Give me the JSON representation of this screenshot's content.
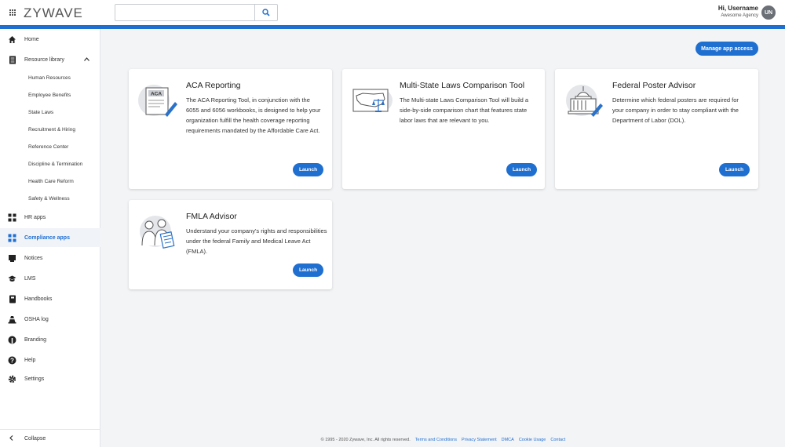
{
  "header": {
    "logo": "ZYWAVE",
    "search": {
      "value": "",
      "placeholder": ""
    },
    "user": {
      "greeting": "Hi, Username",
      "agency": "Awesome Agency",
      "initials": "UN"
    }
  },
  "sidebar": {
    "items": [
      {
        "label": "Home",
        "icon": "home-icon"
      },
      {
        "label": "Resource library",
        "icon": "library-icon"
      },
      {
        "label": "HR apps",
        "icon": "apps-icon"
      },
      {
        "label": "Compliance apps",
        "icon": "apps-icon"
      },
      {
        "label": "Notices",
        "icon": "notices-icon"
      },
      {
        "label": "LMS",
        "icon": "graduation-cap-icon"
      },
      {
        "label": "Handbooks",
        "icon": "book-icon"
      },
      {
        "label": "OSHA log",
        "icon": "cone-icon"
      },
      {
        "label": "Branding",
        "icon": "branding-icon"
      },
      {
        "label": "Help",
        "icon": "help-icon"
      },
      {
        "label": "Settings",
        "icon": "gear-icon"
      }
    ],
    "resource_sub_items": [
      "Human Resources",
      "Employee Benefits",
      "State Laws",
      "Recruitment & Hiring",
      "Reference Center",
      "Discipline & Termination",
      "Health Care Reform",
      "Safety & Wellness"
    ],
    "collapse_label": "Collapse"
  },
  "main": {
    "manage_button": "Manage app access",
    "cards": [
      {
        "title": "ACA Reporting",
        "description": "The ACA Reporting Tool, in conjunction with the 6055 and 6056 workbooks, is designed to help your organization fulfill the health coverage reporting requirements mandated by the Affordable Care Act.",
        "launch": "Launch",
        "illustration_text": "ACA"
      },
      {
        "title": "Multi-State Laws Comparison Tool",
        "description": "The Multi-state Laws Comparison Tool will build a side-by-side comparison chart that features state labor laws that are relevant to you.",
        "launch": "Launch"
      },
      {
        "title": "Federal Poster Advisor",
        "description": "Determine which federal posters are required for your company in order to stay compliant with the Department of Labor (DOL).",
        "launch": "Launch"
      },
      {
        "title": "FMLA Advisor",
        "description": "Understand your company's rights and responsibilities under the federal Family and Medical Leave Act (FMLA).",
        "launch": "Launch"
      }
    ]
  },
  "footer": {
    "copyright": "© 1995 - 2020 Zywave, Inc. All rights reserved.",
    "links": [
      "Terms and Conditions",
      "Privacy Statement",
      "DMCA",
      "Cookie Usage",
      "Contact"
    ]
  },
  "colors": {
    "accent": "#1f6fd1",
    "background": "#f3f4f6"
  }
}
